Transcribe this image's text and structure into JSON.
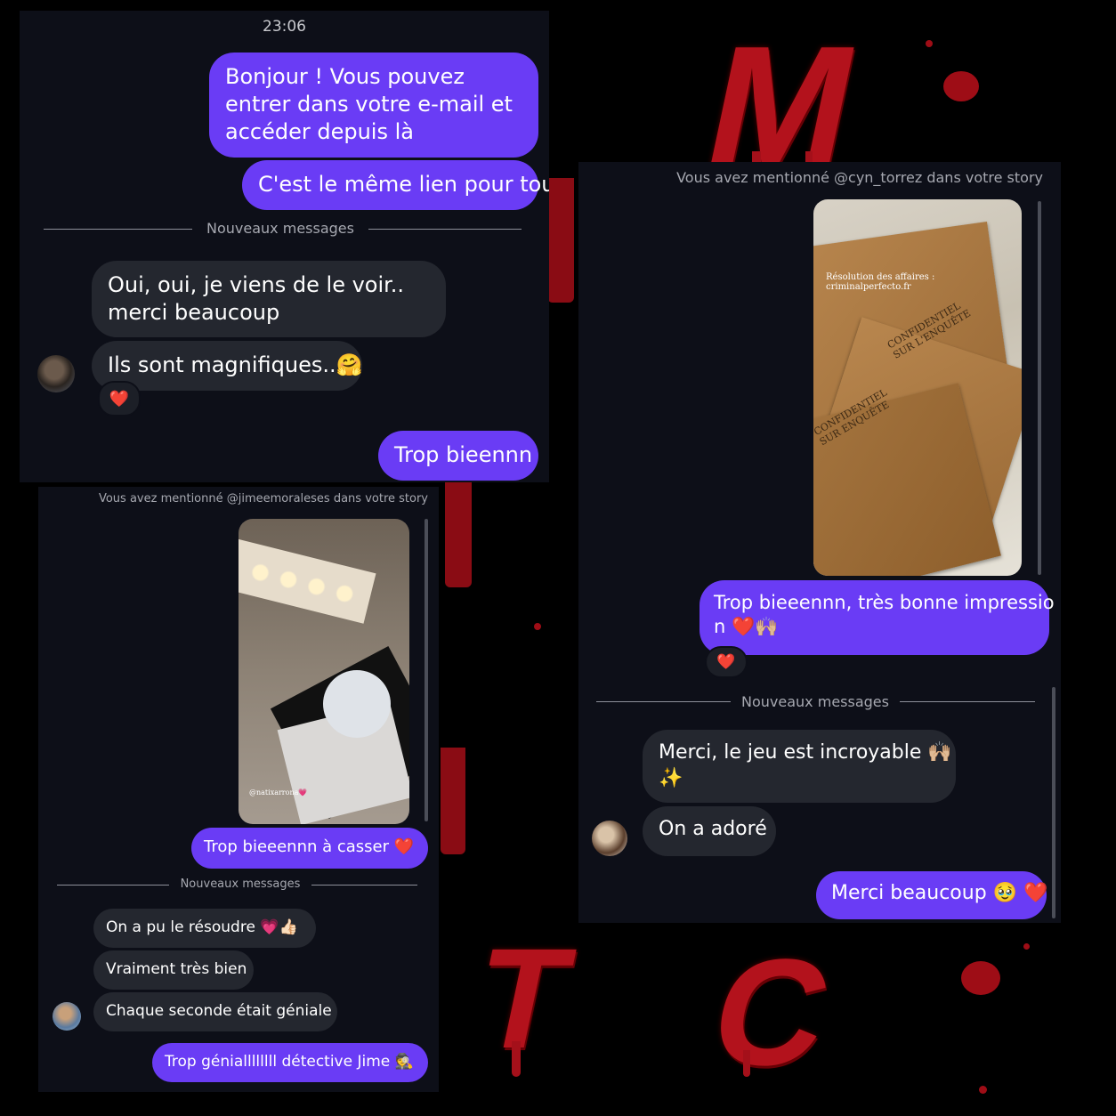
{
  "panel1": {
    "time": "23:06",
    "out1": "Bonjour ! Vous pouvez entrer dans votre e-mail et accéder depuis là",
    "out2": "C'est le même lien pour tout",
    "divider": "Nouveaux messages",
    "in1": "Oui, oui, je viens de le voir.. merci beaucoup",
    "in2": "Ils sont magnifiques..🤗",
    "reaction": "❤️",
    "out3": "Trop bieennn"
  },
  "panel2": {
    "mention": "Vous avez mentionné @cyn_torrez dans votre story",
    "story_caption": "Résolution des affaires : criminalperfecto.fr",
    "stamp1": "CONFIDENTIEL SUR L'ENQUÊTE",
    "stamp2": "CONFIDENTIEL SUR ENQUÊTE",
    "out1": "Trop bieeennn, très bonne impressio",
    "out1b": "n ❤️🙌🏼",
    "reaction": "❤️",
    "divider": "Nouveaux messages",
    "in1": "Merci, le jeu est incroyable 🙌🏼",
    "in1b": "✨",
    "in2": "On a adoré",
    "out2": "Merci beaucoup 🥹 ❤️"
  },
  "panel3": {
    "mention": "Vous avez mentionné @jimeemoraleses dans votre story",
    "story_tag": "@natixarrona💗",
    "out1": "Trop bieeennn à casser ❤️",
    "divider": "Nouveaux messages",
    "in1": "On a pu le résoudre 💗👍🏻",
    "in2": "Vraiment très bien",
    "in3": "Chaque seconde était géniale",
    "out2": "Trop géniallllllll détective Jime 🕵️"
  },
  "background": {
    "letter_m": "M",
    "letter_t": "T",
    "letter_c": "C"
  },
  "colors": {
    "bubble_out": "#6a3cf5",
    "bubble_in": "#24272f",
    "panel_bg": "#0d0f18",
    "blood": "#b3121c"
  }
}
